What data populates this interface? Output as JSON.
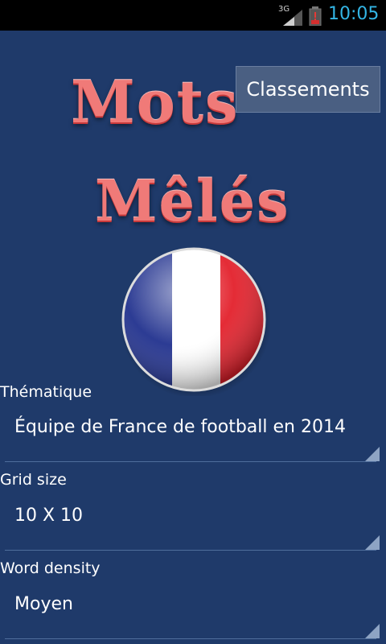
{
  "status": {
    "network": "3G",
    "time": "10:05",
    "time_color": "#33b5e5"
  },
  "logo": {
    "line1": "Mots",
    "line2": "Mêlés",
    "color": "#f07a78"
  },
  "header": {
    "classements_label": "Classements"
  },
  "flag": {
    "colors": [
      "#21318e",
      "#ffffff",
      "#e3202b"
    ]
  },
  "form": {
    "thematique": {
      "label": "Thématique",
      "value": "Équipe de France de football en 2014"
    },
    "grid_size": {
      "label": "Grid size",
      "value": "10 X 10"
    },
    "word_density": {
      "label": "Word density",
      "value": "Moyen"
    }
  },
  "colors": {
    "background": "#1f3a6a",
    "button_bg": "#4a5f82"
  }
}
